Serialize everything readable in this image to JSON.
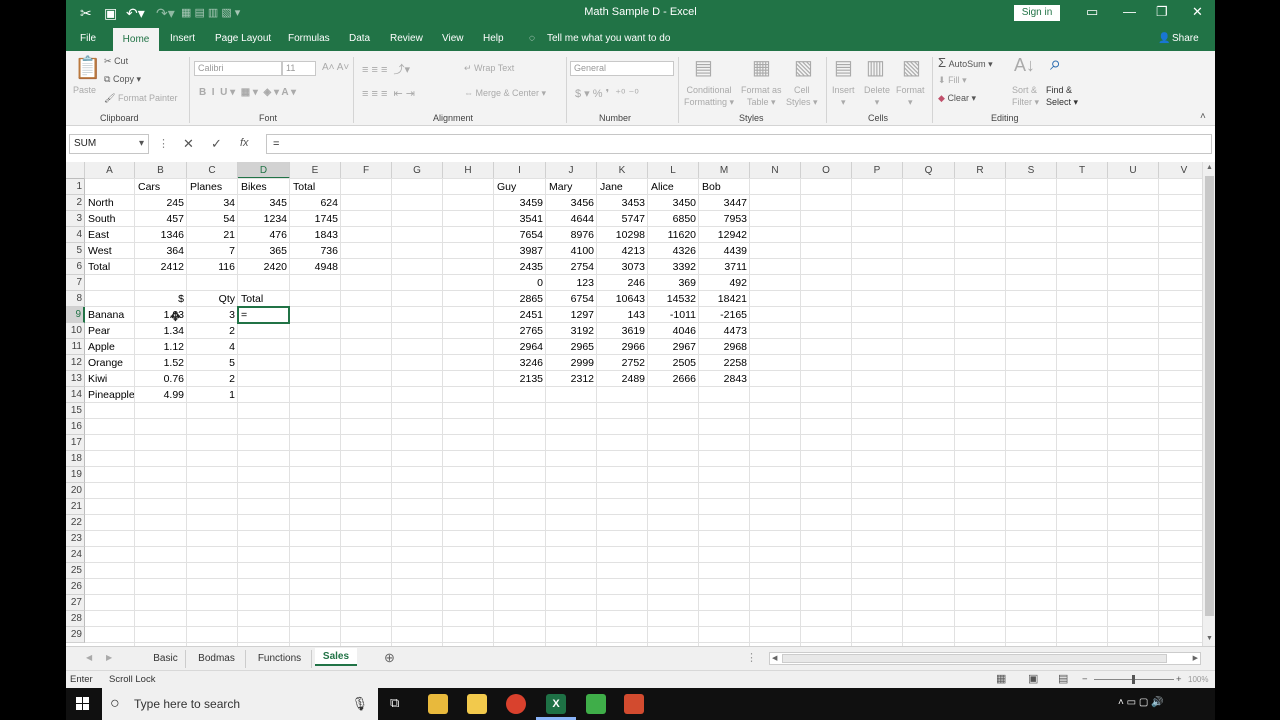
{
  "window": {
    "title": "Math Sample D  -  Excel",
    "sign_in": "Sign in"
  },
  "ribbon_tabs": [
    "File",
    "Home",
    "Insert",
    "Page Layout",
    "Formulas",
    "Data",
    "Review",
    "View",
    "Help"
  ],
  "tell_me": "Tell me what you want to do",
  "share": "Share",
  "ribbon": {
    "clipboard": {
      "label": "Clipboard",
      "paste": "Paste",
      "cut": "Cut",
      "copy": "Copy",
      "format_painter": "Format Painter"
    },
    "font": {
      "label": "Font",
      "font_name": "Calibri",
      "font_size": "11"
    },
    "alignment": {
      "label": "Alignment",
      "wrap_text": "Wrap Text",
      "merge_center": "Merge & Center"
    },
    "number": {
      "label": "Number",
      "format": "General"
    },
    "styles": {
      "label": "Styles",
      "conditional": "Conditional",
      "formatting": "Formatting",
      "format_as": "Format as",
      "table": "Table",
      "cell": "Cell",
      "styles": "Styles"
    },
    "cells": {
      "label": "Cells",
      "insert": "Insert",
      "delete": "Delete",
      "format": "Format"
    },
    "editing": {
      "label": "Editing",
      "autosum": "AutoSum",
      "fill": "Fill",
      "clear": "Clear",
      "sort": "Sort &",
      "filter": "Filter",
      "find": "Find &",
      "select": "Select"
    }
  },
  "formula_bar": {
    "name_box": "SUM",
    "formula": "="
  },
  "columns": [
    "A",
    "B",
    "C",
    "D",
    "E",
    "F",
    "G",
    "H",
    "I",
    "J",
    "K",
    "L",
    "M",
    "N",
    "O",
    "P",
    "Q",
    "R",
    "S",
    "T",
    "U",
    "V"
  ],
  "rows": [
    "1",
    "2",
    "3",
    "4",
    "5",
    "6",
    "7",
    "8",
    "9",
    "10",
    "11",
    "12",
    "13",
    "14",
    "15",
    "16",
    "17",
    "18",
    "19",
    "20",
    "21",
    "22",
    "23",
    "24",
    "25",
    "26",
    "27",
    "28",
    "29"
  ],
  "table1": {
    "headers": [
      "",
      "Cars",
      "Planes",
      "Bikes",
      "Total"
    ],
    "rows": [
      [
        "North",
        "245",
        "34",
        "345",
        "624"
      ],
      [
        "South",
        "457",
        "54",
        "1234",
        "1745"
      ],
      [
        "East",
        "1346",
        "21",
        "476",
        "1843"
      ],
      [
        "West",
        "364",
        "7",
        "365",
        "736"
      ],
      [
        "Total",
        "2412",
        "116",
        "2420",
        "4948"
      ]
    ]
  },
  "table2": {
    "headers": [
      "",
      "$",
      "Qty",
      "Total"
    ],
    "rows": [
      [
        "Banana",
        "1.03",
        "3",
        "="
      ],
      [
        "Pear",
        "1.34",
        "2",
        ""
      ],
      [
        "Apple",
        "1.12",
        "4",
        ""
      ],
      [
        "Orange",
        "1.52",
        "5",
        ""
      ],
      [
        "Kiwi",
        "0.76",
        "2",
        ""
      ],
      [
        "Pineapple",
        "4.99",
        "1",
        ""
      ]
    ]
  },
  "table3": {
    "headers": [
      "Guy",
      "Mary",
      "Jane",
      "Alice",
      "Bob"
    ],
    "rows": [
      [
        "3459",
        "3456",
        "3453",
        "3450",
        "3447"
      ],
      [
        "3541",
        "4644",
        "5747",
        "6850",
        "7953"
      ],
      [
        "7654",
        "8976",
        "10298",
        "11620",
        "12942"
      ],
      [
        "3987",
        "4100",
        "4213",
        "4326",
        "4439"
      ],
      [
        "2435",
        "2754",
        "3073",
        "3392",
        "3711"
      ],
      [
        "0",
        "123",
        "246",
        "369",
        "492"
      ],
      [
        "2865",
        "6754",
        "10643",
        "14532",
        "18421"
      ],
      [
        "2451",
        "1297",
        "143",
        "-1011",
        "-2165"
      ],
      [
        "2765",
        "3192",
        "3619",
        "4046",
        "4473"
      ],
      [
        "2964",
        "2965",
        "2966",
        "2967",
        "2968"
      ],
      [
        "3246",
        "2999",
        "2752",
        "2505",
        "2258"
      ],
      [
        "2135",
        "2312",
        "2489",
        "2666",
        "2843"
      ]
    ]
  },
  "sheet_tabs": [
    "Basic",
    "Bodmas",
    "Functions",
    "Sales"
  ],
  "active_sheet": "Sales",
  "status": {
    "mode": "Enter",
    "scroll_lock": "Scroll Lock",
    "zoom": "100%"
  },
  "taskbar": {
    "search": "Type here to search"
  },
  "colors": {
    "excel_green": "#217346"
  }
}
